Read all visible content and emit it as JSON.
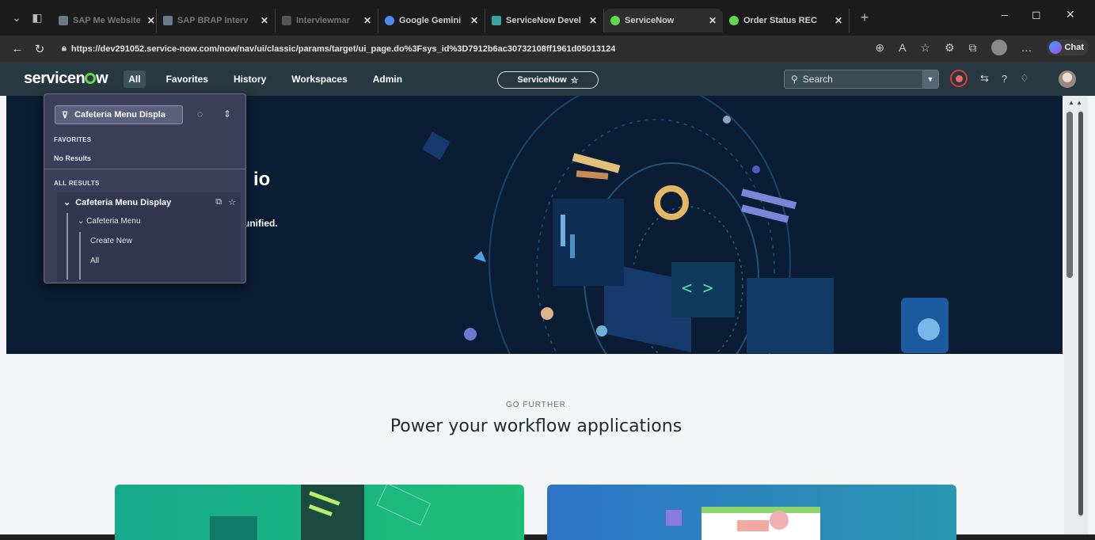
{
  "browser": {
    "tabs": [
      {
        "label": "SAP Me Website",
        "favicon_color": "#6a7a8a",
        "dim": true
      },
      {
        "label": "SAP BRAP Interv",
        "favicon_color": "#6a7a8a",
        "dim": true
      },
      {
        "label": "Interviewmar",
        "favicon_color": "#555555",
        "dim": true
      },
      {
        "label": "Google Gemini",
        "favicon_color": "#4a8cf0",
        "dim": false
      },
      {
        "label": "ServiceNow Devel",
        "favicon_color": "#3aa3a0",
        "dim": false
      },
      {
        "label": "ServiceNow",
        "favicon_color": "#62d84e",
        "dim": false,
        "active": true
      },
      {
        "label": "Order Status REC",
        "favicon_color": "#62d84e",
        "dim": false
      }
    ],
    "new_tab": "+",
    "tab_close": "✕",
    "window": {
      "minimize": "–",
      "maximize": "◻",
      "close": "✕"
    },
    "url": "https://dev291052.service-now.com/now/nav/ui/classic/params/target/ui_page.do%3Fsys_id%3D7912b6ac30732108ff1961d05013124",
    "copilot_label": "Chat"
  },
  "header": {
    "logo": {
      "pre": "servicen",
      "post": "w"
    },
    "menu": [
      {
        "label": "All",
        "active": true
      },
      {
        "label": "Favorites"
      },
      {
        "label": "History"
      },
      {
        "label": "Workspaces"
      },
      {
        "label": "Admin"
      }
    ],
    "scope": "ServiceNow",
    "search_placeholder": "Search"
  },
  "nav_panel": {
    "filter_value": "Cafeteria Menu Displa",
    "favorites_label": "FAVORITES",
    "no_results": "No Results",
    "all_results_label": "ALL RESULTS",
    "group_title": "Cafeteria Menu Display",
    "items": [
      {
        "label": "Cafeteria Menu"
      },
      {
        "label": "Create New"
      },
      {
        "label": "All"
      }
    ]
  },
  "hero": {
    "title_fragment": "io",
    "subtitle_fragment": "unified."
  },
  "main": {
    "eyebrow": "GO FURTHER",
    "title": "Power your workflow applications"
  },
  "colors": {
    "header_bg": "#283841",
    "hero_bg": "#0b1d34",
    "brand_green": "#62d84e",
    "panel_bg": "#3d3f5a"
  }
}
